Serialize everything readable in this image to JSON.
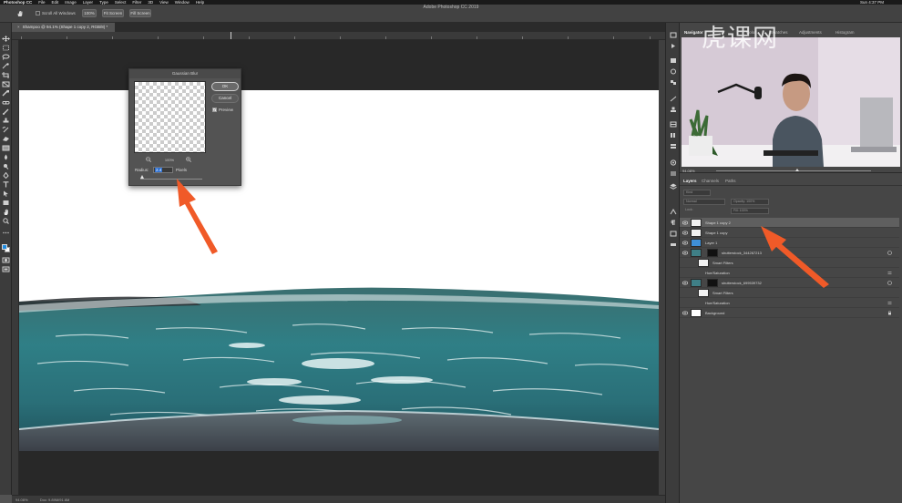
{
  "menubar": {
    "app_name": "Photoshop CC",
    "items": [
      "File",
      "Edit",
      "Image",
      "Layer",
      "Type",
      "Select",
      "Filter",
      "3D",
      "View",
      "Window",
      "Help"
    ],
    "clock": "Sun 4:37 PM"
  },
  "options_bar": {
    "tool_icon": "hand-tool-icon",
    "scroll_all_windows_label": "Scroll All Windows",
    "btn_100": "100%",
    "btn_fit": "Fit Screen",
    "btn_fill": "Fill Screen"
  },
  "app_title": "Adobe Photoshop CC 2019",
  "document_tab": {
    "label": "Shampoo @ 94.1% (Shape 1 copy 2, RGB/8) *"
  },
  "status_bar": {
    "zoom": "94.08%",
    "doc": "Doc: 9.89M/91.6M"
  },
  "navigator": {
    "tabs": [
      "Navigator",
      "Color",
      "Swatches",
      "Adjustments",
      "Histogram"
    ],
    "zoom": "94.08%"
  },
  "watermark": "虎课网",
  "layers_panel": {
    "tabs": [
      "Layers",
      "Channels",
      "Paths"
    ],
    "kind_placeholder": "Kind",
    "blend_mode": "Normal",
    "opacity": "Opacity: 100%",
    "lock_label": "Lock:",
    "fill": "Fill: 100%",
    "layers": [
      {
        "name": "Shape 1 copy 2",
        "selected": true,
        "thumb": "shape"
      },
      {
        "name": "Shape 1 copy",
        "selected": false,
        "thumb": "shape"
      },
      {
        "name": "Layer 1",
        "selected": false,
        "thumb": "blue"
      },
      {
        "name": "shutterstock_344267213",
        "selected": false,
        "thumb": "photo"
      },
      {
        "name": "Smart Filters",
        "selected": false,
        "thumb": "white"
      },
      {
        "name": "Hue/Saturation",
        "selected": false,
        "thumb": "none"
      },
      {
        "name": "shutterstock_699539732",
        "selected": false,
        "thumb": "photo"
      },
      {
        "name": "Smart Filters",
        "selected": false,
        "thumb": "white"
      },
      {
        "name": "Hue/Saturation",
        "selected": false,
        "thumb": "none"
      },
      {
        "name": "Background",
        "selected": false,
        "thumb": "white"
      }
    ]
  },
  "gaussian_blur_dialog": {
    "title": "Gaussian Blur",
    "ok": "OK",
    "cancel": "Cancel",
    "preview_label": "Preview",
    "preview_checked": true,
    "zoom_percent": "100%",
    "radius_label": "Radius:",
    "radius_value": "2.4",
    "units": "Pixels",
    "radius_slider_fraction": 0.03
  },
  "colors": {
    "foreground_swatch": "#1f8be0",
    "annotation_arrow": "#f05a28",
    "water": "#2f7f86"
  }
}
